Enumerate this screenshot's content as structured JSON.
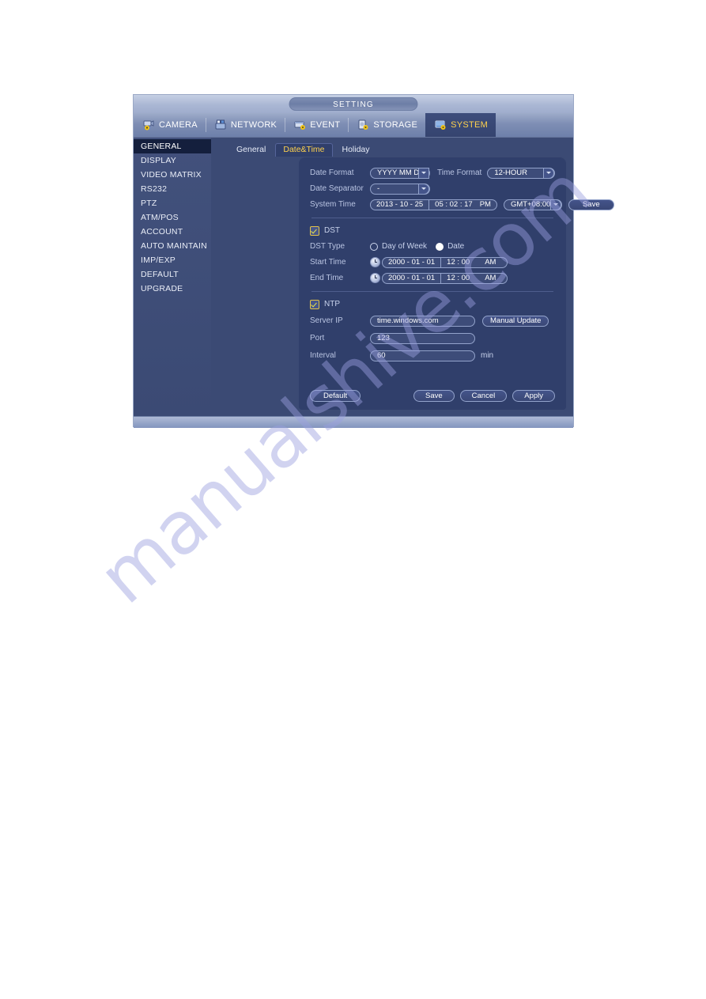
{
  "window": {
    "title": "SETTING"
  },
  "menu": {
    "items": [
      {
        "label": "CAMERA",
        "icon": "camera-gear-icon",
        "active": false
      },
      {
        "label": "NETWORK",
        "icon": "network-icon",
        "active": false
      },
      {
        "label": "EVENT",
        "icon": "event-gear-icon",
        "active": false
      },
      {
        "label": "STORAGE",
        "icon": "storage-gear-icon",
        "active": false
      },
      {
        "label": "SYSTEM",
        "icon": "system-gear-icon",
        "active": true
      }
    ]
  },
  "sidebar": {
    "items": [
      {
        "label": "GENERAL",
        "active": true
      },
      {
        "label": "DISPLAY",
        "active": false
      },
      {
        "label": "VIDEO MATRIX",
        "active": false
      },
      {
        "label": "RS232",
        "active": false
      },
      {
        "label": "PTZ",
        "active": false
      },
      {
        "label": "ATM/POS",
        "active": false
      },
      {
        "label": "ACCOUNT",
        "active": false
      },
      {
        "label": "AUTO MAINTAIN",
        "active": false
      },
      {
        "label": "IMP/EXP",
        "active": false
      },
      {
        "label": "DEFAULT",
        "active": false
      },
      {
        "label": "UPGRADE",
        "active": false
      }
    ]
  },
  "subtabs": [
    {
      "label": "General",
      "active": false
    },
    {
      "label": "Date&Time",
      "active": true
    },
    {
      "label": "Holiday",
      "active": false
    }
  ],
  "form": {
    "date_format": {
      "label": "Date Format",
      "value": "YYYY MM DD"
    },
    "time_format": {
      "label": "Time Format",
      "value": "12-HOUR"
    },
    "date_separator": {
      "label": "Date Separator",
      "value": "-"
    },
    "system_time": {
      "label": "System Time",
      "date": "2013 - 10 - 25",
      "time": "05 : 02 : 17",
      "meridiem": "PM",
      "timezone": "GMT+08:00",
      "save_label": "Save"
    },
    "dst": {
      "label": "DST",
      "checked": true,
      "type_label": "DST Type",
      "option_day_of_week": "Day of Week",
      "option_date": "Date",
      "selected_option": "Date",
      "start": {
        "label": "Start Time",
        "date": "2000 - 01 - 01",
        "time": "12 : 00",
        "meridiem": "AM"
      },
      "end": {
        "label": "End Time",
        "date": "2000 - 01 - 01",
        "time": "12 : 00",
        "meridiem": "AM"
      }
    },
    "ntp": {
      "label": "NTP",
      "checked": true,
      "server_ip": {
        "label": "Server IP",
        "value": "time.windows.com",
        "manual_update_label": "Manual Update"
      },
      "port": {
        "label": "Port",
        "value": "123"
      },
      "interval": {
        "label": "Interval",
        "value": "60",
        "unit": "min"
      }
    }
  },
  "footer": {
    "default_label": "Default",
    "save_label": "Save",
    "cancel_label": "Cancel",
    "apply_label": "Apply"
  },
  "watermark": {
    "text": "manualshive.com"
  },
  "colors": {
    "accent_gold": "#ffd24d",
    "panel_bg": "#303f6b",
    "sidebar_active_bg": "#141f3d",
    "checkbox_border": "#e3c44a"
  }
}
